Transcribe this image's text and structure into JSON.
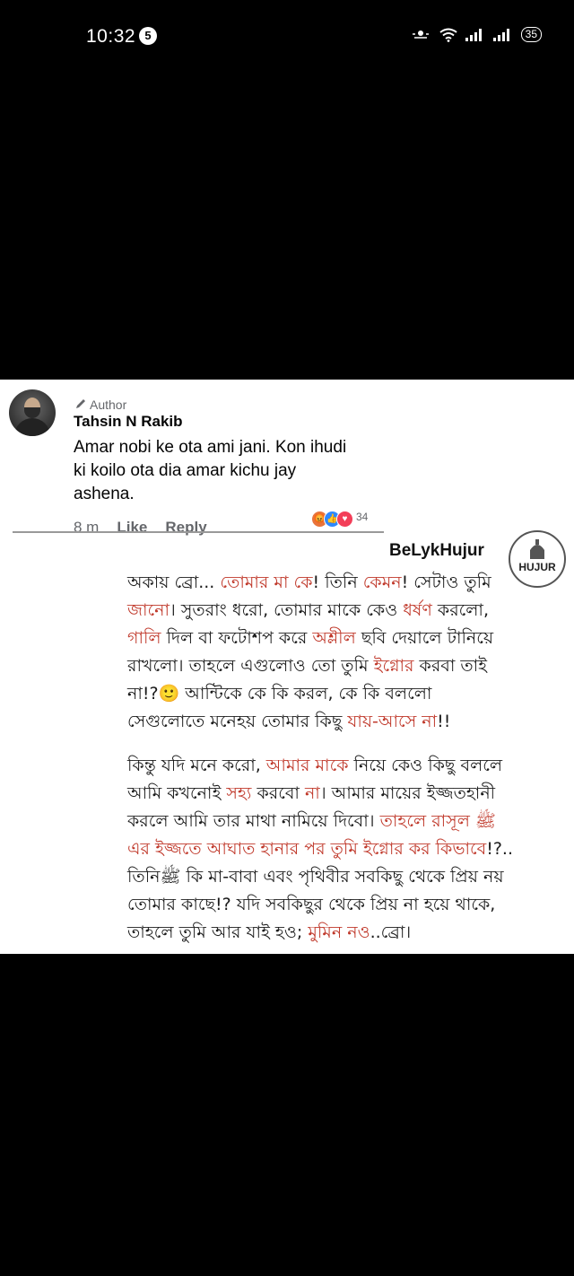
{
  "status_bar": {
    "time": "10:32",
    "notification_count": "5",
    "battery": "35"
  },
  "comment": {
    "badge": "Author",
    "author": "Tahsin N Rakib",
    "text": "Amar nobi ke ota ami jani. Kon ihudi ki koilo ota dia amar kichu jay ashena.",
    "time": "8 m",
    "like_label": "Like",
    "reply_label": "Reply",
    "reaction_icons": [
      "angry-icon",
      "like-icon",
      "love-icon"
    ],
    "reaction_count": "34"
  },
  "quoted_post": {
    "author": "BeLykHujur",
    "logo_text": "HUJUR",
    "paragraph1": [
      {
        "t": "অকায় ব্রো... ",
        "c": "normal"
      },
      {
        "t": "তোমার মা কে",
        "c": "red"
      },
      {
        "t": "! তিনি ",
        "c": "normal"
      },
      {
        "t": "কেমন",
        "c": "red"
      },
      {
        "t": "! সেটাও তুমি ",
        "c": "normal"
      },
      {
        "t": "জানো",
        "c": "red"
      },
      {
        "t": "। সুতরাং ধরো, তোমার মাকে কেও ",
        "c": "normal"
      },
      {
        "t": "ধর্ষণ",
        "c": "red"
      },
      {
        "t": " করলো, ",
        "c": "normal"
      },
      {
        "t": "গালি",
        "c": "red"
      },
      {
        "t": " দিল বা ফটোশপ করে ",
        "c": "normal"
      },
      {
        "t": "অশ্লীল",
        "c": "red"
      },
      {
        "t": " ছবি দেয়ালে টানিয়ে রাখলো। তাহলে এগুলোও তো তুমি ",
        "c": "normal"
      },
      {
        "t": "ইগ্নোর",
        "c": "red"
      },
      {
        "t": " করবা তাই না!?🙂 আন্টিকে কে কি করল, কে কি বললো সেগুলোতে মনেহয় তোমার কিছু ",
        "c": "normal"
      },
      {
        "t": "যায়-আসে না",
        "c": "red"
      },
      {
        "t": "!!",
        "c": "normal"
      }
    ],
    "paragraph2": [
      {
        "t": "কিন্তু যদি মনে করো, ",
        "c": "normal"
      },
      {
        "t": "আমার মাকে",
        "c": "red"
      },
      {
        "t": " নিয়ে কেও কিছু বললে আমি কখনোই ",
        "c": "normal"
      },
      {
        "t": "সহ্য",
        "c": "red"
      },
      {
        "t": " করবো ",
        "c": "normal"
      },
      {
        "t": "না",
        "c": "red"
      },
      {
        "t": "। আমার মায়ের ইজ্জতহানী করলে আমি তার মাথা নামিয়ে দিবো। ",
        "c": "normal"
      },
      {
        "t": "তাহলে রাসূল ﷺ এর ইজ্জতে আঘাত হানার পর তুমি ইগ্নোর কর কিভাবে",
        "c": "red"
      },
      {
        "t": "!?.. তিনিﷺ কি মা-বাবা এবং পৃথিবীর সবকিছু থেকে প্রিয় নয় তোমার কাছে!? যদি সবকিছুর থেকে প্রিয় না হয়ে থাকে, তাহলে তুমি আর যাই হও; ",
        "c": "normal"
      },
      {
        "t": "মুমিন নও",
        "c": "red"
      },
      {
        "t": "..ব্রো।",
        "c": "normal"
      }
    ]
  }
}
